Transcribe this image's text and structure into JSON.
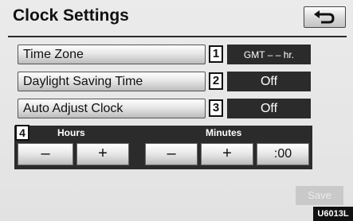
{
  "header": {
    "title": "Clock Settings",
    "back_icon": "return-arrow-icon"
  },
  "settings": [
    {
      "label": "Time Zone",
      "number": "1",
      "value": "GMT – – hr."
    },
    {
      "label": "Daylight Saving Time",
      "number": "2",
      "value": "Off"
    },
    {
      "label": "Auto Adjust Clock",
      "number": "3",
      "value": "Off"
    }
  ],
  "time_adjust": {
    "number": "4",
    "hours_label": "Hours",
    "minutes_label": "Minutes",
    "hours_minus": "–",
    "hours_plus": "+",
    "minutes_minus": "–",
    "minutes_plus": "+",
    "reset_label": ":00"
  },
  "footer": {
    "save_label": "Save",
    "code": "U6013L"
  }
}
